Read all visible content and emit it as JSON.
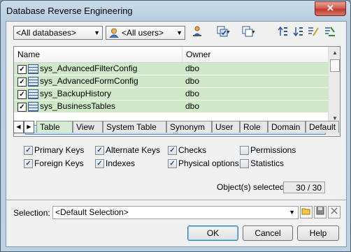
{
  "window": {
    "title": "Database Reverse Engineering",
    "close_glyph": "✕"
  },
  "toolbar": {
    "database_filter": "<All databases>",
    "user_filter": "<All users>",
    "buttons": [
      "owner-filter-icon",
      "select-all-icon",
      "deselect-all-icon",
      "move-up-icon",
      "move-down-icon",
      "filter-icon",
      "clear-filter-icon"
    ]
  },
  "grid": {
    "columns": [
      "Name",
      "Owner"
    ],
    "rows": [
      {
        "name": "sys_AdvancedFilterConfig",
        "owner": "dbo",
        "checked": true
      },
      {
        "name": "sys_AdvancedFormConfig",
        "owner": "dbo",
        "checked": true
      },
      {
        "name": "sys_BackupHistory",
        "owner": "dbo",
        "checked": true
      },
      {
        "name": "sys_BusinessTables",
        "owner": "dbo",
        "checked": true
      }
    ],
    "hscroll_grip": "|||"
  },
  "tabs": [
    "Table",
    "View",
    "System Table",
    "Synonym",
    "User",
    "Role",
    "Domain",
    "Default"
  ],
  "options": [
    {
      "label": "Primary Keys",
      "checked": true
    },
    {
      "label": "Alternate Keys",
      "checked": true
    },
    {
      "label": "Checks",
      "checked": true
    },
    {
      "label": "Permissions",
      "checked": false
    },
    {
      "label": "Foreign Keys",
      "checked": true
    },
    {
      "label": "Indexes",
      "checked": true
    },
    {
      "label": "Physical options",
      "checked": true
    },
    {
      "label": "Statistics",
      "checked": false
    }
  ],
  "status": {
    "label": "Object(s) selected:",
    "value": "30 / 30"
  },
  "selection": {
    "label": "Selection:",
    "value": "<Default Selection>"
  },
  "buttons": {
    "ok": "OK",
    "cancel": "Cancel",
    "help": "Help"
  }
}
